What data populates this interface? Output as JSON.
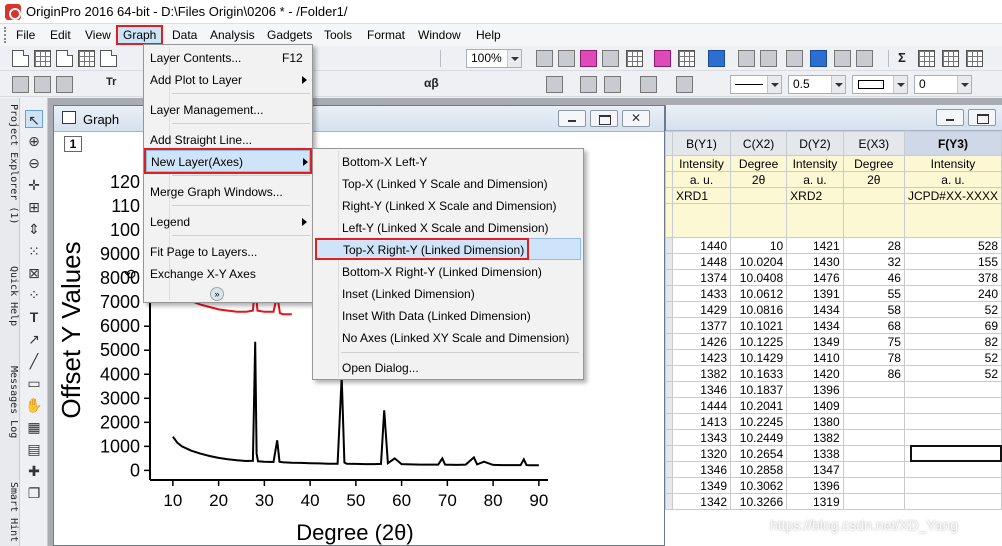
{
  "titlebar": {
    "title": "OriginPro 2016 64-bit - D:\\Files Origin\\0206 * - /Folder1/"
  },
  "menubar": {
    "items": [
      {
        "label": "File"
      },
      {
        "label": "Edit"
      },
      {
        "label": "View"
      },
      {
        "label": "Graph"
      },
      {
        "label": "Data"
      },
      {
        "label": "Analysis"
      },
      {
        "label": "Gadgets"
      },
      {
        "label": "Tools"
      },
      {
        "label": "Format"
      },
      {
        "label": "Window"
      },
      {
        "label": "Help"
      }
    ]
  },
  "toolbar": {
    "zoom": "100%",
    "line_width": "0.5",
    "rotation": "0",
    "text_tool": "Tr",
    "greek_label": "αβ",
    "sigma_label": "Σ",
    "x2_label": "x",
    "icons": [
      "new-project-icon",
      "new-worksheet-icon",
      "new-graph-icon",
      "new-matrix-icon",
      "new-notes-icon",
      "open-icon",
      "save-icon",
      "print-icon",
      "zoom-icon",
      "color-fill-icon",
      "pattern-icon",
      "line-color-icon",
      "font-color-icon"
    ]
  },
  "left_dock": {
    "tabs": [
      "Project Explorer (1)",
      "Quick Help",
      "Messages Log",
      "Smart Hint"
    ]
  },
  "tools": [
    "pointer-icon",
    "zoom-in-icon",
    "zoom-out-icon",
    "data-reader-icon",
    "scale-icon",
    "screen-reader-icon",
    "draw-data-icon",
    "mask-icon",
    "region-icon",
    "text-icon",
    "arrow-icon",
    "line-icon",
    "rectangle-icon",
    "hand-icon",
    "graph-icon",
    "layer-icon",
    "add-icon",
    "copy-icon"
  ],
  "graph_window": {
    "title": "Graph",
    "layer_number": "1",
    "y_axis_label": "Offset Y Values",
    "x_axis_label": "Degree (2θ)"
  },
  "chart_data": {
    "type": "line",
    "xlabel": "Degree (2θ)",
    "ylabel": "Offset Y Values",
    "xlim": [
      5,
      92
    ],
    "ylim": [
      -400,
      12500
    ],
    "x_ticks": [
      10,
      20,
      30,
      40,
      50,
      60,
      70,
      80,
      90
    ],
    "y_ticks": [
      0,
      1000,
      2000,
      3000,
      4000,
      5000,
      6000,
      7000,
      8000,
      9000,
      10000,
      11000,
      12000
    ],
    "y_tick_labels": [
      "0",
      "1000",
      "2000",
      "3000",
      "4000",
      "5000",
      "6000",
      "7000",
      "8000",
      "9000",
      "100",
      "110",
      "120"
    ],
    "series": [
      {
        "color": "#000000",
        "x": [
          10,
          11,
          12,
          14,
          16,
          18,
          20,
          22,
          24,
          26,
          27.5,
          28.0,
          28.3,
          28.6,
          30,
          32,
          32.8,
          33.3,
          34,
          36,
          38,
          40,
          42,
          44,
          46,
          46.9,
          47.5,
          48,
          50,
          52,
          54,
          55.5,
          56.2,
          57,
          58.5,
          60,
          62,
          64,
          66,
          68,
          68.9,
          69.5,
          72,
          74,
          75.8,
          76.5,
          78,
          80,
          82,
          84,
          86,
          86.7,
          87.3,
          88,
          90
        ],
        "y": [
          1400,
          1150,
          1000,
          820,
          700,
          600,
          520,
          460,
          420,
          390,
          400,
          5350,
          700,
          380,
          360,
          350,
          1250,
          360,
          340,
          320,
          310,
          300,
          290,
          280,
          280,
          3900,
          330,
          280,
          270,
          260,
          260,
          270,
          2500,
          300,
          500,
          260,
          250,
          240,
          240,
          240,
          500,
          240,
          230,
          240,
          540,
          250,
          360,
          230,
          220,
          220,
          220,
          460,
          220,
          210,
          210
        ]
      },
      {
        "color": "#e8121a",
        "x": [
          10,
          12,
          14,
          16,
          18,
          20,
          22,
          24,
          26,
          27.5,
          28.0,
          28.5,
          30,
          32,
          32.8,
          33.4,
          34,
          36
        ],
        "y": [
          7800,
          7300,
          7050,
          6900,
          6800,
          6700,
          6650,
          6600,
          6600,
          6650,
          7700,
          6650,
          6600,
          6600,
          7300,
          6550,
          6500,
          6500
        ]
      }
    ]
  },
  "graph_menu": {
    "items": [
      {
        "label": "Layer Contents...",
        "accel": "F12"
      },
      {
        "label": "Add Plot to Layer"
      },
      {
        "label": "Layer Management..."
      },
      {
        "label": "Add Straight Line..."
      },
      {
        "label": "New Layer(Axes)"
      },
      {
        "label": "Merge Graph Windows..."
      },
      {
        "label": "Legend"
      },
      {
        "label": "Fit Page to Layers..."
      },
      {
        "label": "Exchange X-Y Axes"
      }
    ]
  },
  "new_layer_submenu": {
    "items": [
      {
        "label": "Bottom-X Left-Y"
      },
      {
        "label": "Top-X (Linked Y Scale and Dimension)"
      },
      {
        "label": "Right-Y (Linked X Scale and Dimension)"
      },
      {
        "label": "Left-Y (Linked X Scale and Dimension)"
      },
      {
        "label": "Top-X Right-Y (Linked Dimension)"
      },
      {
        "label": "Bottom-X Right-Y (Linked Dimension)"
      },
      {
        "label": "Inset (Linked Dimension)"
      },
      {
        "label": "Inset With Data (Linked Dimension)"
      },
      {
        "label": "No Axes (Linked XY Scale and Dimension)"
      },
      {
        "label": "Open Dialog..."
      }
    ]
  },
  "worksheet": {
    "columns": [
      {
        "header": "B(Y1)",
        "long_name": "Intensity",
        "units": "a. u.",
        "comments": "XRD1"
      },
      {
        "header": "C(X2)",
        "long_name": "Degree",
        "units": "2θ",
        "comments": ""
      },
      {
        "header": "D(Y2)",
        "long_name": "Intensity",
        "units": "a. u.",
        "comments": "XRD2"
      },
      {
        "header": "E(X3)",
        "long_name": "Degree",
        "units": "2θ",
        "comments": ""
      },
      {
        "header": "F(Y3)",
        "long_name": "Intensity",
        "units": "a. u.",
        "comments": "JCPD#XX-XXXX"
      }
    ],
    "rows": [
      [
        "1440",
        "10",
        "1421",
        "28",
        "528"
      ],
      [
        "1448",
        "10.0204",
        "1430",
        "32",
        "155"
      ],
      [
        "1374",
        "10.0408",
        "1476",
        "46",
        "378"
      ],
      [
        "1433",
        "10.0612",
        "1391",
        "55",
        "240"
      ],
      [
        "1429",
        "10.0816",
        "1434",
        "58",
        "52"
      ],
      [
        "1377",
        "10.1021",
        "1434",
        "68",
        "69"
      ],
      [
        "1426",
        "10.1225",
        "1349",
        "75",
        "82"
      ],
      [
        "1423",
        "10.1429",
        "1410",
        "78",
        "52"
      ],
      [
        "1382",
        "10.1633",
        "1420",
        "86",
        "52"
      ],
      [
        "1346",
        "10.1837",
        "1396",
        "",
        ""
      ],
      [
        "1444",
        "10.2041",
        "1409",
        "",
        ""
      ],
      [
        "1413",
        "10.2245",
        "1380",
        "",
        ""
      ],
      [
        "1343",
        "10.2449",
        "1382",
        "",
        ""
      ],
      [
        "1320",
        "10.2654",
        "1338",
        "",
        ""
      ],
      [
        "1346",
        "10.2858",
        "1347",
        "",
        ""
      ],
      [
        "1349",
        "10.3062",
        "1396",
        "",
        ""
      ],
      [
        "1342",
        "10.3266",
        "1319",
        "",
        ""
      ]
    ]
  },
  "watermark": "https://blog.csdn.net/XD_Yang"
}
